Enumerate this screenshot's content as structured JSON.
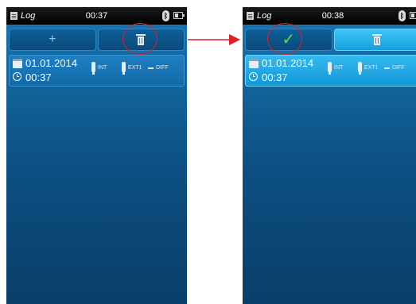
{
  "left_screen": {
    "statusbar": {
      "title": "Log",
      "time": "00:37",
      "bluetooth_icon": "bluetooth-icon",
      "battery_icon": "battery-icon"
    },
    "toolbar": {
      "add_label": "+",
      "delete_icon": "trash-icon"
    },
    "entry": {
      "date": "01.01.2014",
      "time": "00:37",
      "int_label": "INT",
      "ext_label": "EXT1",
      "diff_label": "DIFF"
    }
  },
  "right_screen": {
    "statusbar": {
      "title": "Log",
      "time": "00:38",
      "bluetooth_icon": "bluetooth-icon",
      "battery_icon": "battery-icon"
    },
    "toolbar": {
      "confirm_label": "✓",
      "delete_icon": "trash-icon"
    },
    "entry": {
      "date": "01.01.2014",
      "time": "00:37",
      "int_label": "INT",
      "ext_label": "EXT1",
      "diff_label": "DIFF"
    }
  },
  "colors": {
    "accent": "#13a0e0",
    "highlight_circle": "#e01f26",
    "check": "#4ee24e",
    "background_top": "#1776b4",
    "background_bottom": "#0a3e69"
  }
}
